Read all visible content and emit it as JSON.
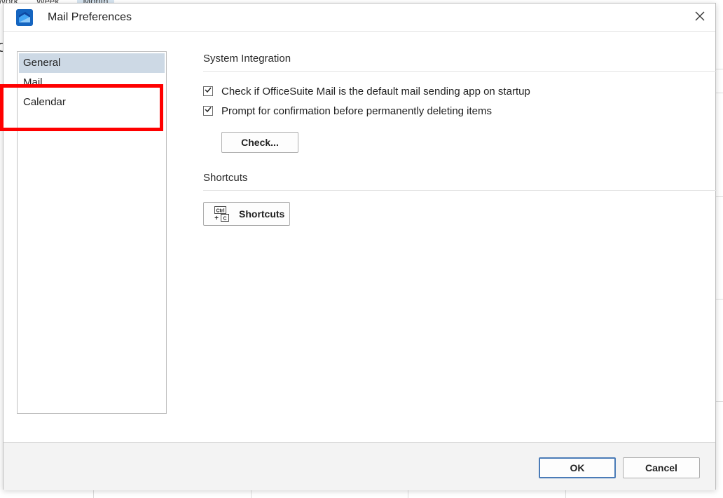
{
  "background": {
    "tabs": [
      "Work",
      "Week",
      "Month"
    ],
    "fragment_letter": "C"
  },
  "dialog": {
    "title": "Mail Preferences",
    "app_icon": "officesuite-mail-icon",
    "close_icon": "close-icon"
  },
  "sidebar": {
    "items": [
      {
        "label": "General",
        "selected": true
      },
      {
        "label": "Mail",
        "selected": false
      },
      {
        "label": "Calendar",
        "selected": false
      }
    ]
  },
  "system_integration": {
    "title": "System Integration",
    "options": [
      {
        "label": "Check if OfficeSuite Mail is the default mail sending app on startup",
        "checked": true
      },
      {
        "label": "Prompt for confirmation before permanently deleting items",
        "checked": true
      }
    ],
    "check_button": "Check..."
  },
  "shortcuts": {
    "title": "Shortcuts",
    "button_label": "Shortcuts",
    "icon": "keyboard-shortcut-icon",
    "icon_text": {
      "key1": "Ctrl",
      "plus": "+",
      "key2": "C"
    }
  },
  "footer": {
    "ok": "OK",
    "cancel": "Cancel"
  },
  "colors": {
    "selected_bg": "#cdd9e5",
    "highlight": "#ff0000",
    "ok_border": "#4a7bb7",
    "app_icon_blue": "#1565c0"
  }
}
